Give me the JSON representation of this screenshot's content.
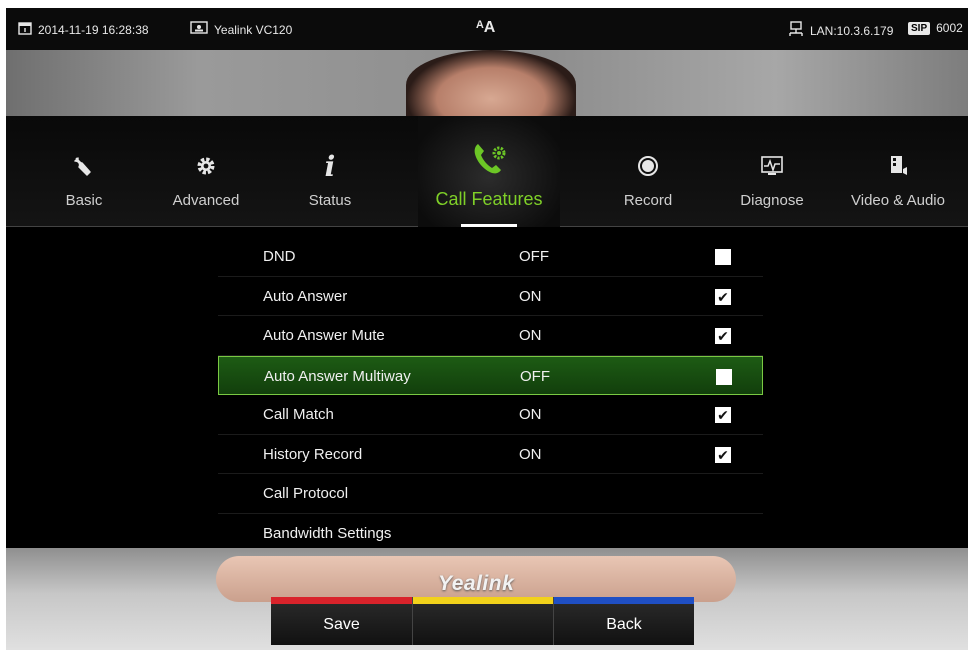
{
  "statusbar": {
    "datetime": "2014-11-19 16:28:38",
    "device": "Yealink VC120",
    "font_toggle": "ᴬA",
    "lan": "LAN:10.3.6.179",
    "sip_badge": "SIP",
    "sip_account": "6002"
  },
  "tabs": [
    {
      "label": "Basic",
      "icon": "wrench-icon"
    },
    {
      "label": "Advanced",
      "icon": "gear-icon"
    },
    {
      "label": "Status",
      "icon": "info-icon"
    },
    {
      "label": "Call Features",
      "icon": "phone-gear-icon",
      "active": true
    },
    {
      "label": "Record",
      "icon": "record-icon"
    },
    {
      "label": "Diagnose",
      "icon": "diagnose-icon"
    },
    {
      "label": "Video & Audio",
      "icon": "video-audio-icon"
    }
  ],
  "settings": [
    {
      "name": "DND",
      "value": "OFF",
      "checked": false
    },
    {
      "name": "Auto Answer",
      "value": "ON",
      "checked": true
    },
    {
      "name": "Auto Answer Mute",
      "value": "ON",
      "checked": true
    },
    {
      "name": "Auto Answer Multiway",
      "value": "OFF",
      "checked": false,
      "selected": true
    },
    {
      "name": "Call Match",
      "value": "ON",
      "checked": true
    },
    {
      "name": "History Record",
      "value": "ON",
      "checked": true
    },
    {
      "name": "Call Protocol",
      "value": ""
    },
    {
      "name": "Bandwidth Settings",
      "value": ""
    }
  ],
  "brand": "Yealink",
  "softkeys": [
    {
      "label": "Save",
      "color": "#d9232b"
    },
    {
      "label": "",
      "color": "#f2d21b"
    },
    {
      "label": "Back",
      "color": "#1f4fc4"
    }
  ],
  "colors": {
    "accent": "#7fd028",
    "selected_row": "#1d5b14"
  }
}
